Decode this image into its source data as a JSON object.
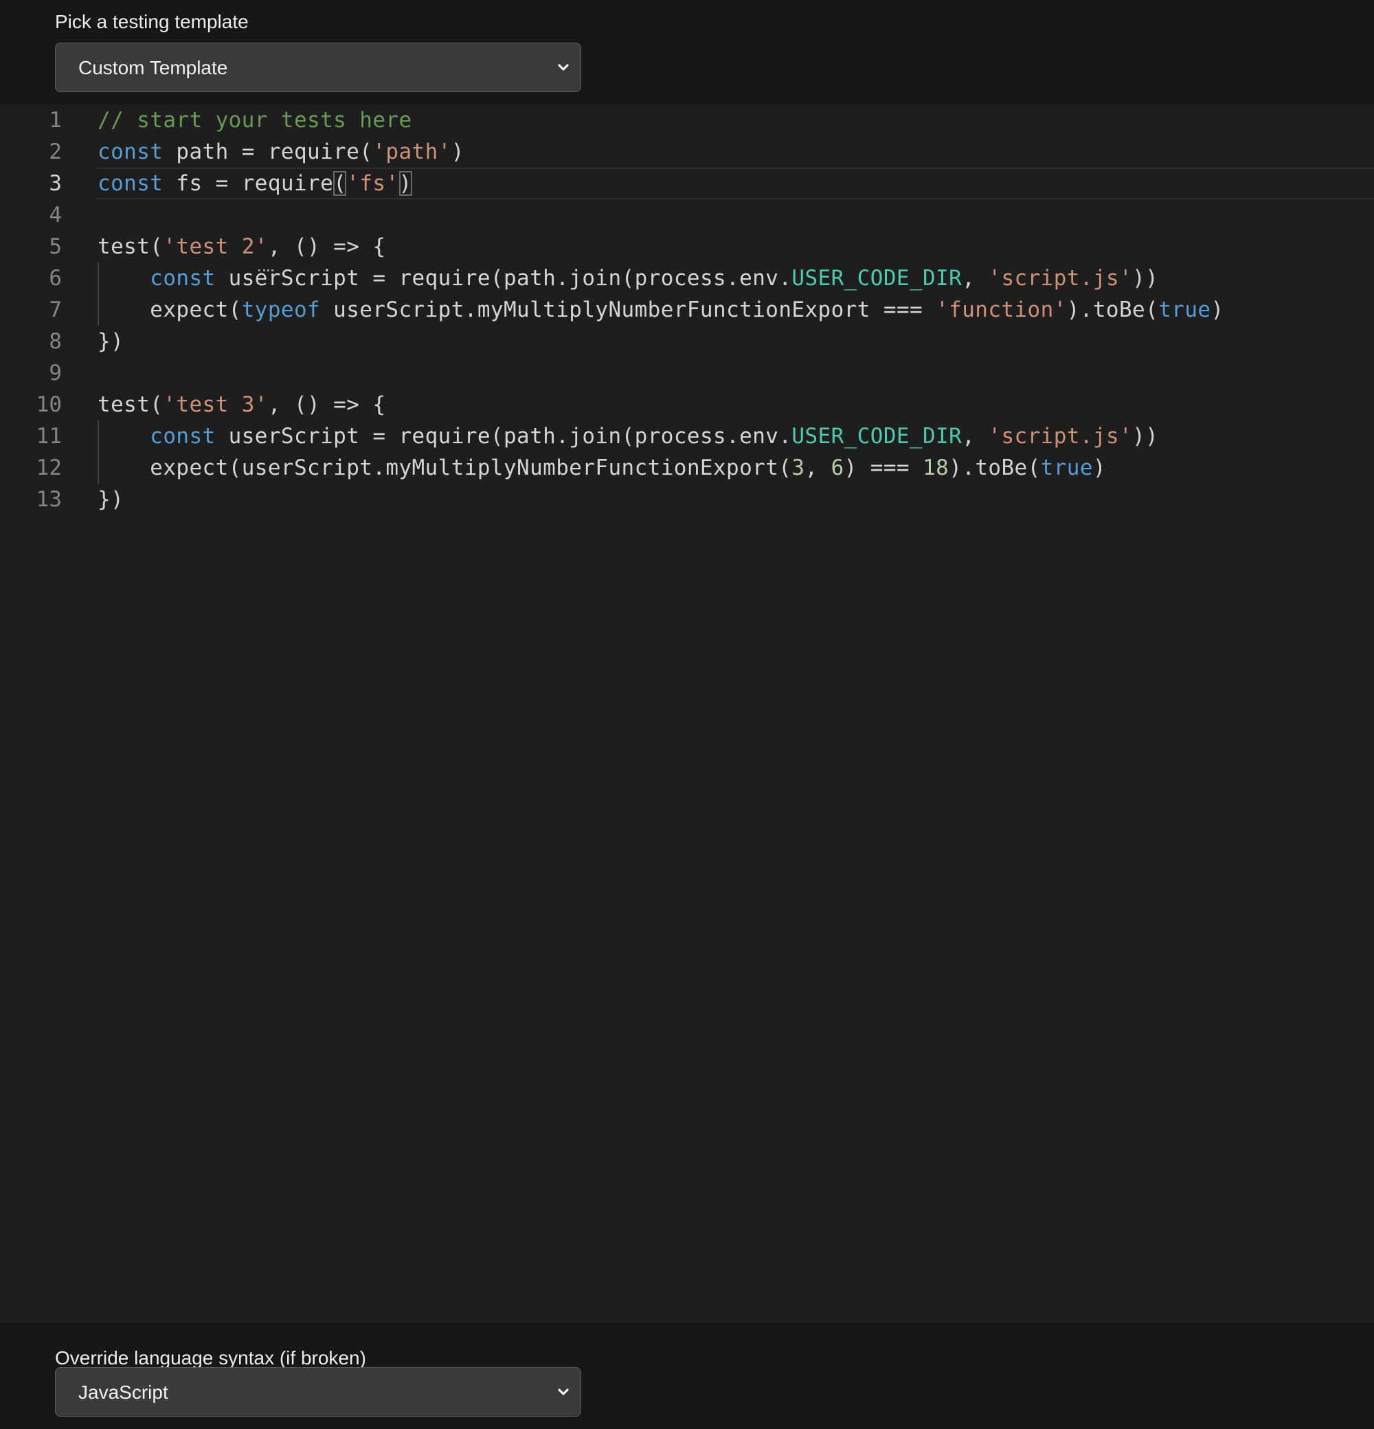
{
  "template_picker": {
    "label": "Pick a testing template",
    "selected": "Custom Template",
    "chevron_icon": "chevron-down-icon"
  },
  "editor": {
    "current_line": 3,
    "lines": [
      {
        "number": "1",
        "tokens": [
          {
            "t": "// start your tests here",
            "c": "comment"
          }
        ]
      },
      {
        "number": "2",
        "tokens": [
          {
            "t": "const",
            "c": "keyword"
          },
          {
            "t": " path = require(",
            "c": "plain"
          },
          {
            "t": "'path'",
            "c": "string"
          },
          {
            "t": ")",
            "c": "plain"
          }
        ]
      },
      {
        "number": "3",
        "tokens": [
          {
            "t": "const",
            "c": "keyword"
          },
          {
            "t": " ",
            "c": "plain"
          },
          {
            "t": "fs",
            "c": "plain"
          },
          {
            "t": " = require",
            "c": "plain"
          },
          {
            "t": "(",
            "c": "bracket"
          },
          {
            "t": "'fs'",
            "c": "string"
          },
          {
            "t": ")",
            "c": "bracket"
          }
        ]
      },
      {
        "number": "4",
        "tokens": []
      },
      {
        "number": "5",
        "tokens": [
          {
            "t": "test(",
            "c": "plain"
          },
          {
            "t": "'test 2'",
            "c": "string"
          },
          {
            "t": ", () => {",
            "c": "plain"
          }
        ]
      },
      {
        "number": "6",
        "tokens": [
          {
            "t": "    ",
            "c": "plain"
          },
          {
            "t": "const",
            "c": "keyword"
          },
          {
            "t": " userScript = require(path.join(process.env.",
            "c": "plain"
          },
          {
            "t": "USER_CODE_DIR",
            "c": "const"
          },
          {
            "t": ", ",
            "c": "plain"
          },
          {
            "t": "'script.js'",
            "c": "string"
          },
          {
            "t": "))",
            "c": "plain"
          }
        ]
      },
      {
        "number": "7",
        "tokens": [
          {
            "t": "    expect(",
            "c": "plain"
          },
          {
            "t": "typeof",
            "c": "keyword"
          },
          {
            "t": " userScript.myMultiplyNumberFunctionExport === ",
            "c": "plain"
          },
          {
            "t": "'function'",
            "c": "string"
          },
          {
            "t": ").toBe(",
            "c": "plain"
          },
          {
            "t": "true",
            "c": "keyword"
          },
          {
            "t": ")",
            "c": "plain"
          }
        ]
      },
      {
        "number": "8",
        "tokens": [
          {
            "t": "})",
            "c": "plain"
          }
        ]
      },
      {
        "number": "9",
        "tokens": []
      },
      {
        "number": "10",
        "tokens": [
          {
            "t": "test(",
            "c": "plain"
          },
          {
            "t": "'test 3'",
            "c": "string"
          },
          {
            "t": ", () => {",
            "c": "plain"
          }
        ]
      },
      {
        "number": "11",
        "tokens": [
          {
            "t": "    ",
            "c": "plain"
          },
          {
            "t": "const",
            "c": "keyword"
          },
          {
            "t": " userScript = require(path.join(process.env.",
            "c": "plain"
          },
          {
            "t": "USER_CODE_DIR",
            "c": "const"
          },
          {
            "t": ", ",
            "c": "plain"
          },
          {
            "t": "'script.js'",
            "c": "string"
          },
          {
            "t": "))",
            "c": "plain"
          }
        ]
      },
      {
        "number": "12",
        "tokens": [
          {
            "t": "    expect(userScript.myMultiplyNumberFunctionExport(",
            "c": "plain"
          },
          {
            "t": "3",
            "c": "number"
          },
          {
            "t": ", ",
            "c": "plain"
          },
          {
            "t": "6",
            "c": "number"
          },
          {
            "t": ") === ",
            "c": "plain"
          },
          {
            "t": "18",
            "c": "number"
          },
          {
            "t": ").toBe(",
            "c": "plain"
          },
          {
            "t": "true",
            "c": "keyword"
          },
          {
            "t": ")",
            "c": "plain"
          }
        ]
      },
      {
        "number": "13",
        "tokens": [
          {
            "t": "})",
            "c": "plain"
          }
        ]
      }
    ]
  },
  "language_override": {
    "label": "Override language syntax (if broken)",
    "selected": "JavaScript",
    "chevron_icon": "chevron-down-icon"
  },
  "colors": {
    "background": "#171717",
    "editor_background": "#1e1e1e",
    "comment": "#6a9955",
    "keyword": "#569cd6",
    "string": "#ce9178",
    "constant": "#4ec9b0",
    "number": "#b5cea8"
  }
}
